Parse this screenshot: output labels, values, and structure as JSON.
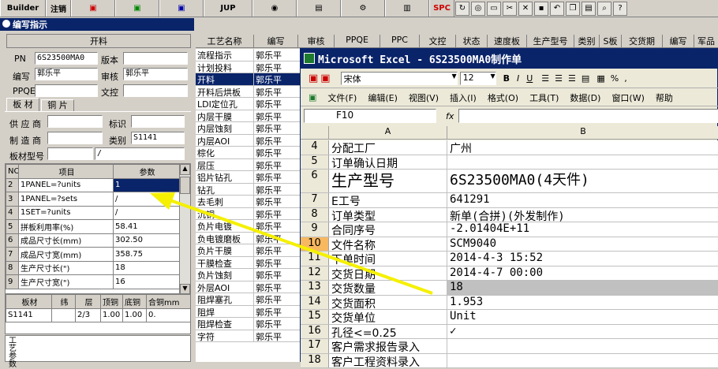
{
  "toolbar": {
    "builder": "Builder",
    "logout": "注销",
    "jup": "JUP",
    "spc": "SPC"
  },
  "left": {
    "title": "编写指示",
    "section": "开料",
    "pn_label": "PN",
    "pn_value": "6S23500MA0",
    "version_label": "版本",
    "author_label": "编写",
    "author_value": "郭乐平",
    "reviewer_label": "审核",
    "reviewer_value": "郭乐平",
    "ppqe_label": "PPQE",
    "docreview_label": "文控",
    "tabs": [
      "板 材",
      "铜 片"
    ],
    "supplier_label": "供 应 商",
    "mark_label": "标识",
    "maker_label": "制 造 商",
    "category_label": "类别",
    "category_value": "S1141",
    "model_label": "板材型号",
    "model_value": "/",
    "params_headers": [
      "NO",
      "项目",
      "参数"
    ],
    "params": [
      {
        "no": "2",
        "item": "1PANEL=?units",
        "val": "1"
      },
      {
        "no": "3",
        "item": "1PANEL=?sets",
        "val": "/"
      },
      {
        "no": "4",
        "item": "1SET=?units",
        "val": "/"
      },
      {
        "no": "5",
        "item": "拼板利用率(%)",
        "val": "58.41"
      },
      {
        "no": "6",
        "item": "成品尺寸长(mm)",
        "val": "302.50"
      },
      {
        "no": "7",
        "item": "成品尺寸宽(mm)",
        "val": "358.75"
      },
      {
        "no": "8",
        "item": "生产尺寸长(\")",
        "val": "18"
      },
      {
        "no": "9",
        "item": "生产尺寸宽(\")",
        "val": "16"
      }
    ],
    "mat_headers": [
      "板材",
      "纬",
      "层",
      "顶铜",
      "底铜",
      "合铜mm"
    ],
    "mat_row": [
      "S1141",
      "",
      "2/3",
      "1.00",
      "1.00",
      "0."
    ],
    "process_label": "工艺参数"
  },
  "mid": {
    "headers": [
      "工艺名称",
      "编写",
      "审核",
      "PPQE",
      "PPC",
      "文控",
      "状态",
      "速度板",
      "生产型号",
      "类别",
      "S板",
      "交货期",
      "编写",
      "军品"
    ],
    "rows": [
      {
        "name": "流程指示",
        "author": "郭乐平"
      },
      {
        "name": "计划投料",
        "author": "郭乐平"
      },
      {
        "name": "开料",
        "author": "郭乐平"
      },
      {
        "name": "开料后烘板",
        "author": "郭乐平"
      },
      {
        "name": "LDI定位孔",
        "author": "郭乐平"
      },
      {
        "name": "内层干膜",
        "author": "郭乐平"
      },
      {
        "name": "内层蚀刻",
        "author": "郭乐平"
      },
      {
        "name": "内层AOI",
        "author": "郭乐平"
      },
      {
        "name": "棕化",
        "author": "郭乐平"
      },
      {
        "name": "层压",
        "author": "郭乐平"
      },
      {
        "name": "铝片钻孔",
        "author": "郭乐平"
      },
      {
        "name": "钻孔",
        "author": "郭乐平"
      },
      {
        "name": "去毛刺",
        "author": "郭乐平"
      },
      {
        "name": "沉铜",
        "author": "郭乐平"
      },
      {
        "name": "负片电镀",
        "author": "郭乐平"
      },
      {
        "name": "负电镀磨板",
        "author": "郭乐平"
      },
      {
        "name": "负片干膜",
        "author": "郭乐平"
      },
      {
        "name": "干膜检查",
        "author": "郭乐平"
      },
      {
        "name": "负片蚀刻",
        "author": "郭乐平"
      },
      {
        "name": "外层AOI",
        "author": "郭乐平"
      },
      {
        "name": "阻焊塞孔",
        "author": "郭乐平"
      },
      {
        "name": "阻焊",
        "author": "郭乐平"
      },
      {
        "name": "阻焊检查",
        "author": "郭乐平"
      },
      {
        "name": "字符",
        "author": "郭乐平"
      }
    ]
  },
  "excel": {
    "title": "Microsoft Excel - 6S23500MA0制作单",
    "font": "宋体",
    "size": "12",
    "menus": [
      "文件(F)",
      "编辑(E)",
      "视图(V)",
      "插入(I)",
      "格式(O)",
      "工具(T)",
      "数据(D)",
      "窗口(W)",
      "帮助"
    ],
    "cellref": "F10",
    "fx": "fx",
    "col_a": "A",
    "col_b": "B",
    "rows": [
      {
        "n": "4",
        "a": "分配工厂",
        "b": "广州"
      },
      {
        "n": "5",
        "a": "订单确认日期",
        "b": ""
      },
      {
        "n": "6",
        "a": "生产型号",
        "b": "6S23500MA0(4天件)"
      },
      {
        "n": "7",
        "a": "E工号",
        "b": "641291"
      },
      {
        "n": "8",
        "a": "订单类型",
        "b": "新单(合拼)(外发制作)"
      },
      {
        "n": "9",
        "a": "合同序号",
        "b": "-2.01404E+11"
      },
      {
        "n": "10",
        "a": "文件名称",
        "b": "SCM9040"
      },
      {
        "n": "11",
        "a": "下单时间",
        "b": "2014-4-3 15:52"
      },
      {
        "n": "12",
        "a": "交货日期",
        "b": "2014-4-7 00:00"
      },
      {
        "n": "13",
        "a": "交货数量",
        "b": "18"
      },
      {
        "n": "14",
        "a": "交货面积",
        "b": "1.953"
      },
      {
        "n": "15",
        "a": "交货单位",
        "b": "Unit"
      },
      {
        "n": "16",
        "a": "孔径<=0.25",
        "b": "✓"
      },
      {
        "n": "17",
        "a": "客户需求报告录入",
        "b": ""
      },
      {
        "n": "18",
        "a": "客户工程资料录入",
        "b": ""
      }
    ]
  },
  "colors": {
    "title_bar": "#0a246a",
    "selected": "#0a246a",
    "arrow": "#f5f000"
  }
}
